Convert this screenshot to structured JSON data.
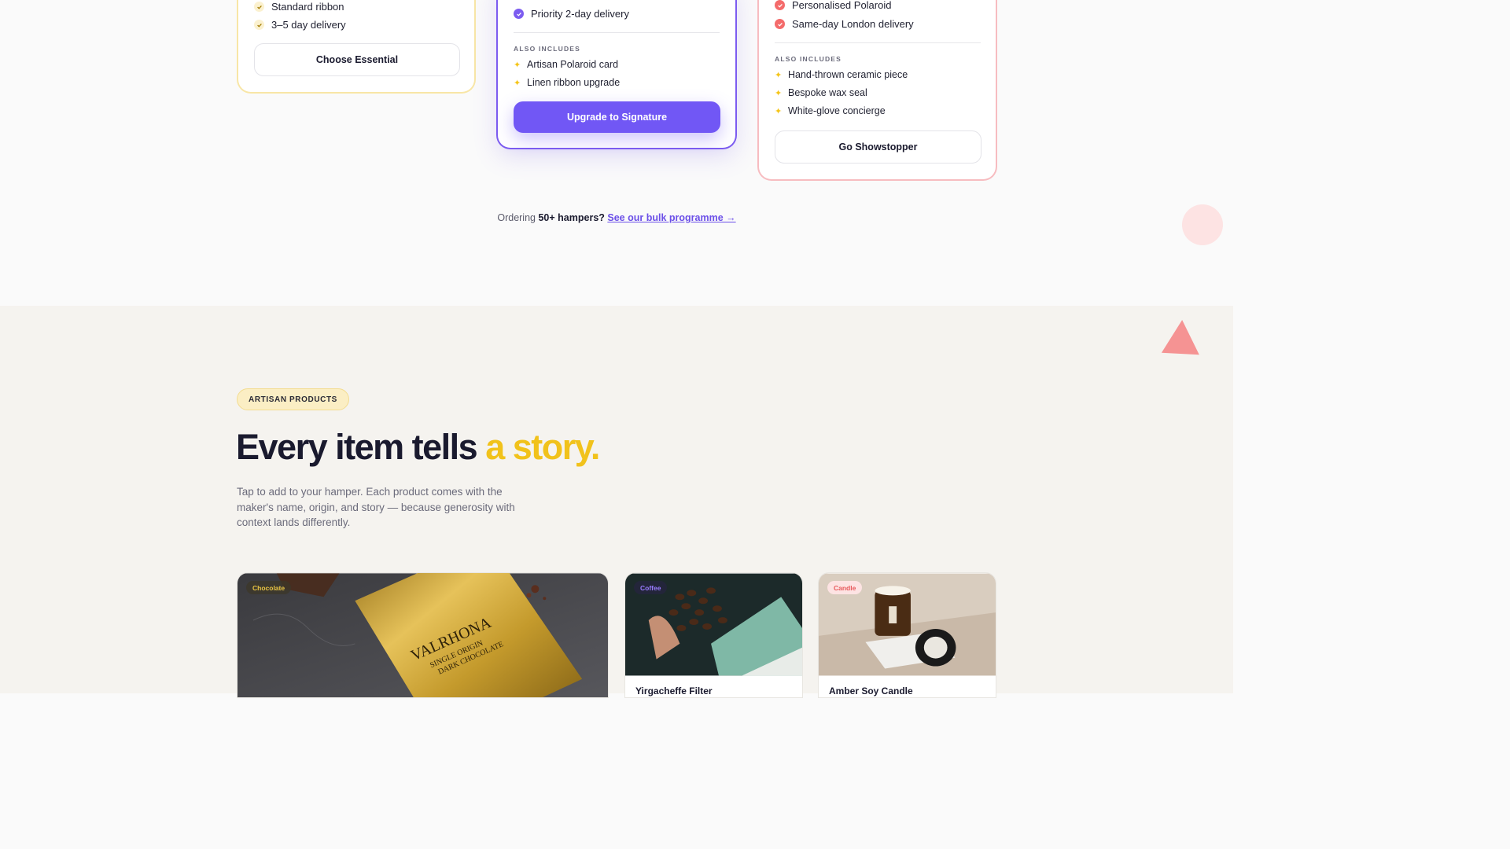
{
  "pricing": {
    "essential": {
      "features": [
        "Standard ribbon",
        "3–5 day delivery"
      ],
      "cta": "Choose Essential"
    },
    "signature": {
      "features": [
        "Priority 2-day delivery"
      ],
      "also_includes_label": "ALSO INCLUDES",
      "extras": [
        "Artisan Polaroid card",
        "Linen ribbon upgrade"
      ],
      "cta": "Upgrade to Signature"
    },
    "showstopper": {
      "features": [
        "Personalised Polaroid",
        "Same-day London delivery"
      ],
      "also_includes_label": "ALSO INCLUDES",
      "extras": [
        "Hand-thrown ceramic piece",
        "Bespoke wax seal",
        "White-glove concierge"
      ],
      "cta": "Go Showstopper"
    },
    "bulk": {
      "prefix": "Ordering",
      "strong": "50+ hampers?",
      "link": "See our bulk programme →"
    }
  },
  "products": {
    "eyebrow": "ARTISAN PRODUCTS",
    "heading_main": "Every item tells",
    "heading_accent": "a story.",
    "subtext": "Tap to add to your hamper. Each product comes with the maker's name, origin, and story — because generosity with context lands differently.",
    "items": [
      {
        "tag": "Chocolate",
        "name": "",
        "image_brand": "VALRHONA",
        "image_line1": "SINGLE ORIGIN",
        "image_line2": "DARK CHOCOLATE"
      },
      {
        "tag": "Coffee",
        "name": "Yirgacheffe Filter"
      },
      {
        "tag": "Candle",
        "name": "Amber Soy Candle"
      }
    ]
  },
  "colors": {
    "accent_purple": "#7157f5",
    "accent_yellow": "#f1c21b",
    "accent_red": "#f46b6b"
  }
}
